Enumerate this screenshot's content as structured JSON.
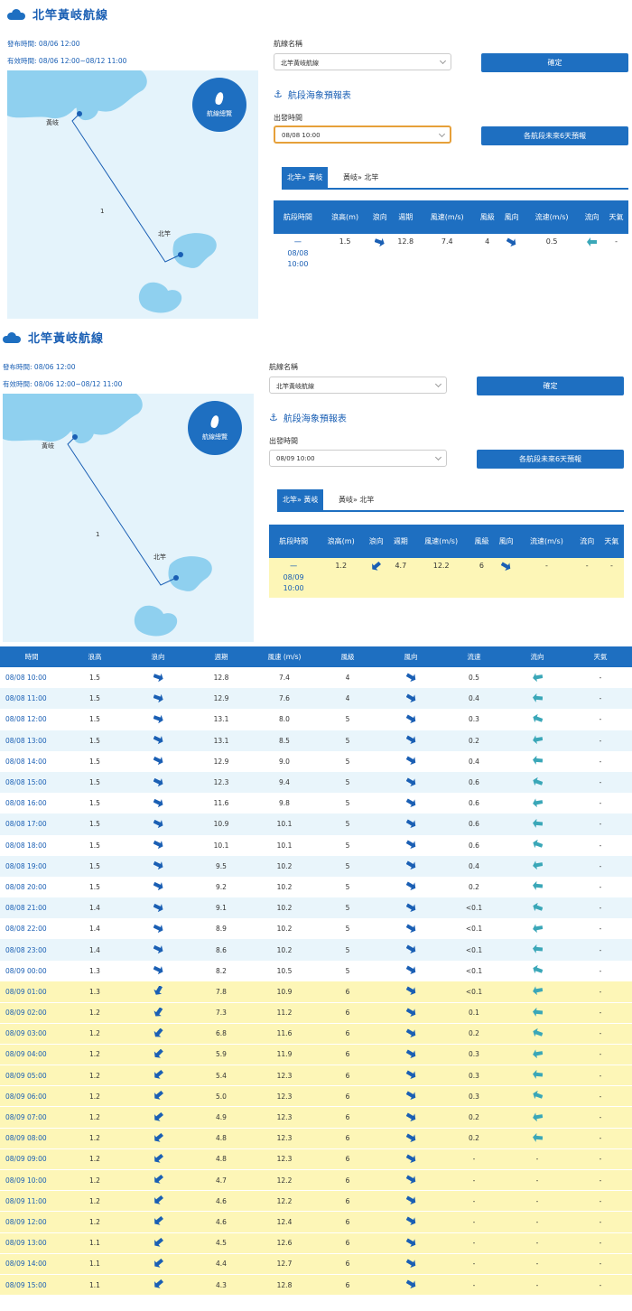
{
  "page": {
    "title": "北竿黃岐航線",
    "issue_label": "發布時間:",
    "issue_value": "08/06 12:00",
    "valid_label": "有效時間:",
    "valid_value": "08/06 12:00~08/12 11:00",
    "map_button": "航線總覽",
    "map_labels": {
      "huangqi": "黃岐",
      "beigan": "北竿",
      "segment": "1"
    },
    "route_name_label": "航線名稱",
    "route_name_value": "北竿黃岐航線",
    "confirm_button": "確定",
    "forecast_title": "航段海象預報表",
    "depart_label": "出發時間",
    "six_day_button": "各航段未來6天預報",
    "tab_forward": "北竿» 黃岐",
    "tab_back": "黃岐» 北竿",
    "colors": {
      "primary": "#1e6fc1",
      "highlight": "#fdf6b7",
      "alt_row": "#e9f5fb",
      "focus": "#e6a03a"
    }
  },
  "segment_headers": [
    "航段時間",
    "浪高(m)",
    "浪向",
    "週期",
    "風速(m/s)",
    "風級",
    "風向",
    "流速(m/s)",
    "流向",
    "天氣"
  ],
  "panel1": {
    "depart_value": "08/08 10:00",
    "row": {
      "time_a": "一",
      "time_b": "08/08",
      "time_c": "10:00",
      "wave": "1.5",
      "period": "12.8",
      "wind": "7.4",
      "level": "4",
      "current": "0.5",
      "weather": "-"
    }
  },
  "panel2": {
    "depart_value": "08/09 10:00",
    "row": {
      "time_a": "一",
      "time_b": "08/09",
      "time_c": "10:00",
      "wave": "1.2",
      "period": "4.7",
      "wind": "12.2",
      "level": "6",
      "current": "-",
      "current_dir": "-",
      "weather": "-"
    }
  },
  "table": {
    "headers": [
      "時間",
      "浪高",
      "浪向",
      "週期",
      "風速 (m/s)",
      "風級",
      "風向",
      "流速",
      "流向",
      "天氣"
    ],
    "rows": [
      [
        "08/08 10:00",
        "1.5",
        "12.8",
        "7.4",
        "4",
        "0.5",
        "-",
        0
      ],
      [
        "08/08 11:00",
        "1.5",
        "12.9",
        "7.6",
        "4",
        "0.4",
        "-",
        0
      ],
      [
        "08/08 12:00",
        "1.5",
        "13.1",
        "8.0",
        "5",
        "0.3",
        "-",
        0
      ],
      [
        "08/08 13:00",
        "1.5",
        "13.1",
        "8.5",
        "5",
        "0.2",
        "-",
        0
      ],
      [
        "08/08 14:00",
        "1.5",
        "12.9",
        "9.0",
        "5",
        "0.4",
        "-",
        0
      ],
      [
        "08/08 15:00",
        "1.5",
        "12.3",
        "9.4",
        "5",
        "0.6",
        "-",
        0
      ],
      [
        "08/08 16:00",
        "1.5",
        "11.6",
        "9.8",
        "5",
        "0.6",
        "-",
        0
      ],
      [
        "08/08 17:00",
        "1.5",
        "10.9",
        "10.1",
        "5",
        "0.6",
        "-",
        0
      ],
      [
        "08/08 18:00",
        "1.5",
        "10.1",
        "10.1",
        "5",
        "0.6",
        "-",
        0
      ],
      [
        "08/08 19:00",
        "1.5",
        "9.5",
        "10.2",
        "5",
        "0.4",
        "-",
        0
      ],
      [
        "08/08 20:00",
        "1.5",
        "9.2",
        "10.2",
        "5",
        "0.2",
        "-",
        0
      ],
      [
        "08/08 21:00",
        "1.4",
        "9.1",
        "10.2",
        "5",
        "<0.1",
        "-",
        0
      ],
      [
        "08/08 22:00",
        "1.4",
        "8.9",
        "10.2",
        "5",
        "<0.1",
        "-",
        0
      ],
      [
        "08/08 23:00",
        "1.4",
        "8.6",
        "10.2",
        "5",
        "<0.1",
        "-",
        0
      ],
      [
        "08/09 00:00",
        "1.3",
        "8.2",
        "10.5",
        "5",
        "<0.1",
        "-",
        0
      ],
      [
        "08/09 01:00",
        "1.3",
        "7.8",
        "10.9",
        "6",
        "<0.1",
        "-",
        1
      ],
      [
        "08/09 02:00",
        "1.2",
        "7.3",
        "11.2",
        "6",
        "0.1",
        "-",
        1
      ],
      [
        "08/09 03:00",
        "1.2",
        "6.8",
        "11.6",
        "6",
        "0.2",
        "-",
        1
      ],
      [
        "08/09 04:00",
        "1.2",
        "5.9",
        "11.9",
        "6",
        "0.3",
        "-",
        1
      ],
      [
        "08/09 05:00",
        "1.2",
        "5.4",
        "12.3",
        "6",
        "0.3",
        "-",
        1
      ],
      [
        "08/09 06:00",
        "1.2",
        "5.0",
        "12.3",
        "6",
        "0.3",
        "-",
        1
      ],
      [
        "08/09 07:00",
        "1.2",
        "4.9",
        "12.3",
        "6",
        "0.2",
        "-",
        1
      ],
      [
        "08/09 08:00",
        "1.2",
        "4.8",
        "12.3",
        "6",
        "0.2",
        "-",
        1
      ],
      [
        "08/09 09:00",
        "1.2",
        "4.8",
        "12.3",
        "6",
        "-",
        "-",
        2
      ],
      [
        "08/09 10:00",
        "1.2",
        "4.7",
        "12.2",
        "6",
        "-",
        "-",
        2
      ],
      [
        "08/09 11:00",
        "1.2",
        "4.6",
        "12.2",
        "6",
        "-",
        "-",
        2
      ],
      [
        "08/09 12:00",
        "1.2",
        "4.6",
        "12.4",
        "6",
        "-",
        "-",
        2
      ],
      [
        "08/09 13:00",
        "1.1",
        "4.5",
        "12.6",
        "6",
        "-",
        "-",
        2
      ],
      [
        "08/09 14:00",
        "1.1",
        "4.4",
        "12.7",
        "6",
        "-",
        "-",
        2
      ],
      [
        "08/09 15:00",
        "1.1",
        "4.3",
        "12.8",
        "6",
        "-",
        "-",
        2
      ]
    ]
  }
}
